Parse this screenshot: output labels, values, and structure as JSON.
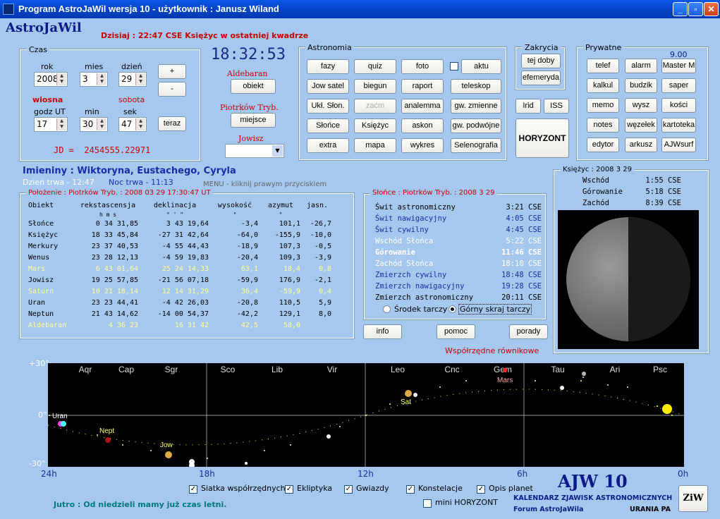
{
  "window": {
    "title": "Program AstroJaWil wersja 10 - użytkownik : Janusz Wiland",
    "min": "_",
    "max": "▫",
    "close": "✕"
  },
  "app": {
    "logo": "AstroJaWil",
    "today": "Dzisiaj : 22:47 CSE Księżyc w ostatniej kwadrze"
  },
  "czas": {
    "label": "Czas",
    "rok_lbl": "rok",
    "mies_lbl": "mies",
    "dzien_lbl": "dzień",
    "rok": "2008",
    "mies": "3",
    "dzien": "29",
    "plus": "+",
    "minus": "-",
    "season": "wiosna",
    "weekday": "sobota",
    "godz_lbl": "godz UT",
    "min_lbl": "min",
    "sek_lbl": "sek",
    "godz": "17",
    "min": "30",
    "sek": "47",
    "teraz": "teraz",
    "jd": "JD =  2454555.22971"
  },
  "clock": {
    "time": "18:32:53",
    "star": "Aldebaran",
    "obiekt": "obiekt",
    "city": "Piotrków Tryb.",
    "miejsce": "miejsce",
    "planet": "Jowisz"
  },
  "astronomia": {
    "label": "Astronomia",
    "buttons": [
      "fazy",
      "quiz",
      "foto",
      "aktu",
      "Jow satel",
      "biegun",
      "raport",
      "teleskop",
      "Ukł. Słon.",
      "zaćm",
      "analemma",
      "gw. zmienne",
      "Słońce",
      "Księżyc",
      "askon",
      "gw. podwójne",
      "extra",
      "mapa",
      "wykres",
      "Selenografia"
    ]
  },
  "zakrycia": {
    "label": "Zakrycia",
    "b1": "tej doby",
    "b2": "efemeryda",
    "irid": "Irid",
    "iss": "ISS",
    "horyzont": "HORYZONT"
  },
  "prywatne": {
    "label": "Prywatne",
    "version": "9.00",
    "buttons": [
      "telef",
      "alarm",
      "Master M",
      "kalkul",
      "budzik",
      "saper",
      "memo",
      "wysz",
      "kości",
      "notes",
      "węzełek",
      "kartoteka",
      "edytor",
      "arkusz",
      "AJWsurf"
    ]
  },
  "names": {
    "imieniny": "Imieniny : Wiktoryna, Eustachego, Cyryla",
    "day": "Dzień trwa - 12:47",
    "night": "Noc trwa - 11:13",
    "menu": "MENU - kliknij prawym przyciskiem"
  },
  "position": {
    "label": "Położenie : Piotrków Tryb. : 2008 03 29   17:30:47 UT",
    "header": [
      "Obiekt",
      "rekstascensja",
      "deklinacja",
      "wysokość",
      "azymut",
      "jasn."
    ],
    "units": [
      "",
      "h  m  s",
      "°  '  \"",
      "°",
      "°",
      ""
    ],
    "rows": [
      [
        "Słońce",
        "0 34 31,85",
        "3 43 19,64",
        "-3,4",
        "101,1",
        "-26,7"
      ],
      [
        "Księżyc",
        "18 33 45,84",
        "-27 31 42,64",
        "-64,0",
        "-155,9",
        "-10,0"
      ],
      [
        "Merkury",
        "23 37 40,53",
        "-4 55 44,43",
        "-18,9",
        "107,3",
        "-0,5"
      ],
      [
        "Wenus",
        "23 28 12,13",
        "-4 59 19,83",
        "-20,4",
        "109,3",
        "-3,9"
      ],
      [
        "Mars",
        "6 43 01,64",
        "25 24 14,33",
        "63,1",
        "18,4",
        "0,8"
      ],
      [
        "Jowisz",
        "19 25 57,85",
        "-21 56 07,18",
        "-59,9",
        "176,9",
        "-2,1"
      ],
      [
        "Saturn",
        "10 21 18,14",
        "12 14 31,29",
        "36,4",
        "-59,9",
        "0,4"
      ],
      [
        "Uran",
        "23 23 44,41",
        "-4 42 26,03",
        "-20,8",
        "110,5",
        "5,9"
      ],
      [
        "Neptun",
        "21 43 14,62",
        "-14 00 54,37",
        "-42,2",
        "129,1",
        "8,0"
      ],
      [
        "Aldebaran",
        "4 36 23",
        "16 31 42",
        "42,5",
        "58,0",
        ""
      ]
    ]
  },
  "sun": {
    "label": "Słońce : Piotrków Tryb. : 2008  3  29",
    "rows": [
      [
        "Świt astronomiczny",
        "3:21 CSE"
      ],
      [
        "Świt nawigacyjny",
        "4:05 CSE"
      ],
      [
        "Świt cywilny",
        "4:45 CSE"
      ],
      [
        "Wschód Słońca",
        "5:22 CSE"
      ],
      [
        "Górowanie",
        "11:46 CSE"
      ],
      [
        "Zachód Słońca",
        "18:10 CSE"
      ],
      [
        "Zmierzch cywilny",
        "18:48 CSE"
      ],
      [
        "Zmierzch nawigacyjny",
        "19:28 CSE"
      ],
      [
        "Zmierzch astronomiczny",
        "20:11 CSE"
      ]
    ],
    "r1": "Środek tarczy",
    "r2": "Górny skraj tarczy"
  },
  "moon": {
    "label": "Księżyc : 2008  3  29",
    "rows": [
      [
        "Wschód",
        "1:55 CSE"
      ],
      [
        "Górowanie",
        "5:18 CSE"
      ],
      [
        "Zachód",
        "8:39 CSE"
      ]
    ]
  },
  "buttons": {
    "info": "info",
    "pomoc": "pomoc",
    "porady": "porady"
  },
  "chart": {
    "title": "Współrzędne równikowe",
    "y_top": "+30°",
    "y_mid": "0°",
    "y_bot": "-30°",
    "x_labels": [
      "24h",
      "18h",
      "12h",
      "6h",
      "0h"
    ],
    "constellations": [
      "Aqr",
      "Cap",
      "Sgr",
      "Sco",
      "Lib",
      "Vir",
      "Leo",
      "Cnc",
      "Gem",
      "Tau",
      "Ari",
      "Psc"
    ],
    "planets": [
      {
        "name": "Uran",
        "color": "#ffffff"
      },
      {
        "name": "Nept",
        "color": "#ffff66"
      },
      {
        "name": "Jow",
        "color": "#ffff66"
      },
      {
        "name": "Sat",
        "color": "#ffff66"
      },
      {
        "name": "Mars",
        "color": "#ffaaaa"
      }
    ]
  },
  "options": {
    "siatka": "Siatka współrzędnych",
    "ekliptyka": "Ekliptyka",
    "gwiazdy": "Gwiazdy",
    "konstelacje": "Konstelacje",
    "opis": "Opis planet",
    "mini": "mini HORYZONT"
  },
  "footer": {
    "jutro": "Jutro : Od niedzieli mamy już czas letni.",
    "ajw": "AJW 10",
    "kal": "KALENDARZ ZJAWISK ASTRONOMICZNYCH",
    "forum": "Forum AstroJaWila",
    "urania": "URANIA PA",
    "ziw": "ZiW"
  }
}
